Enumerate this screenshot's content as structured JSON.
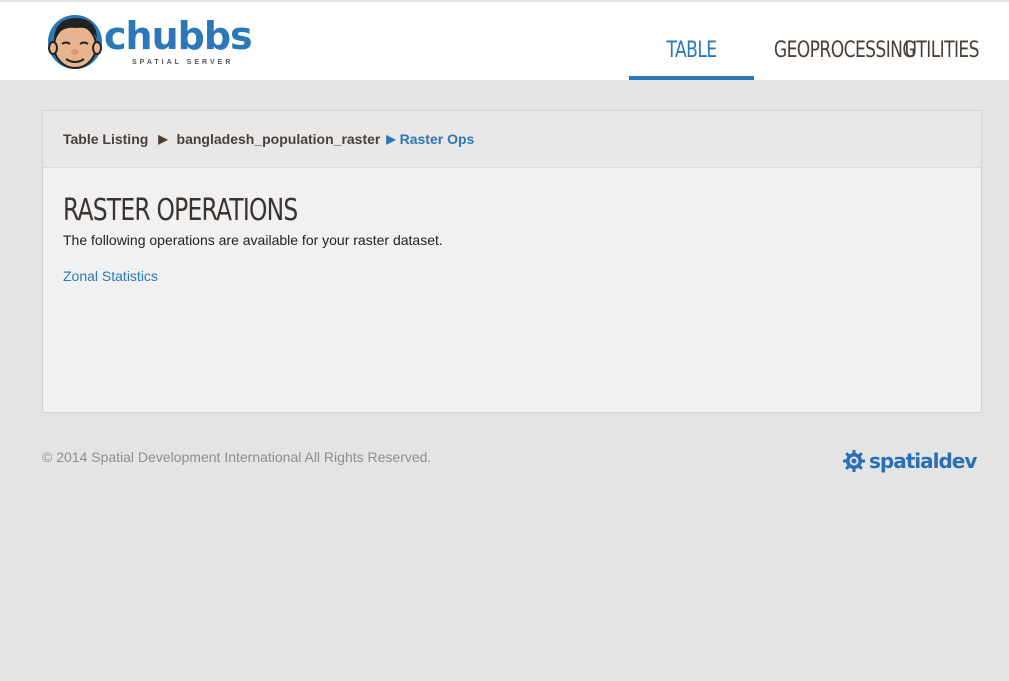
{
  "header": {
    "logo_text": "chubbs",
    "logo_subtext": "SPATIAL SERVER",
    "nav": [
      {
        "label": "TABLE LISTING",
        "active": true
      },
      {
        "label": "GEOPROCESSING",
        "active": false
      },
      {
        "label": "UTILITIES",
        "active": false
      }
    ]
  },
  "breadcrumb": {
    "items": [
      "Table Listing",
      "bangladesh_population_raster"
    ],
    "current": "Raster Ops"
  },
  "main": {
    "title": "RASTER OPERATIONS",
    "description": "The following operations are available for your raster dataset.",
    "operations": [
      "Zonal Statistics"
    ]
  },
  "footer": {
    "copyright": "© 2014 Spatial Development International All Rights Reserved.",
    "logo_text": "spatialdev"
  },
  "colors": {
    "accent": "#2b77b8",
    "background": "#e4e4e4",
    "panel": "#f1f1f1",
    "nav_text": "#4a3f3a"
  }
}
